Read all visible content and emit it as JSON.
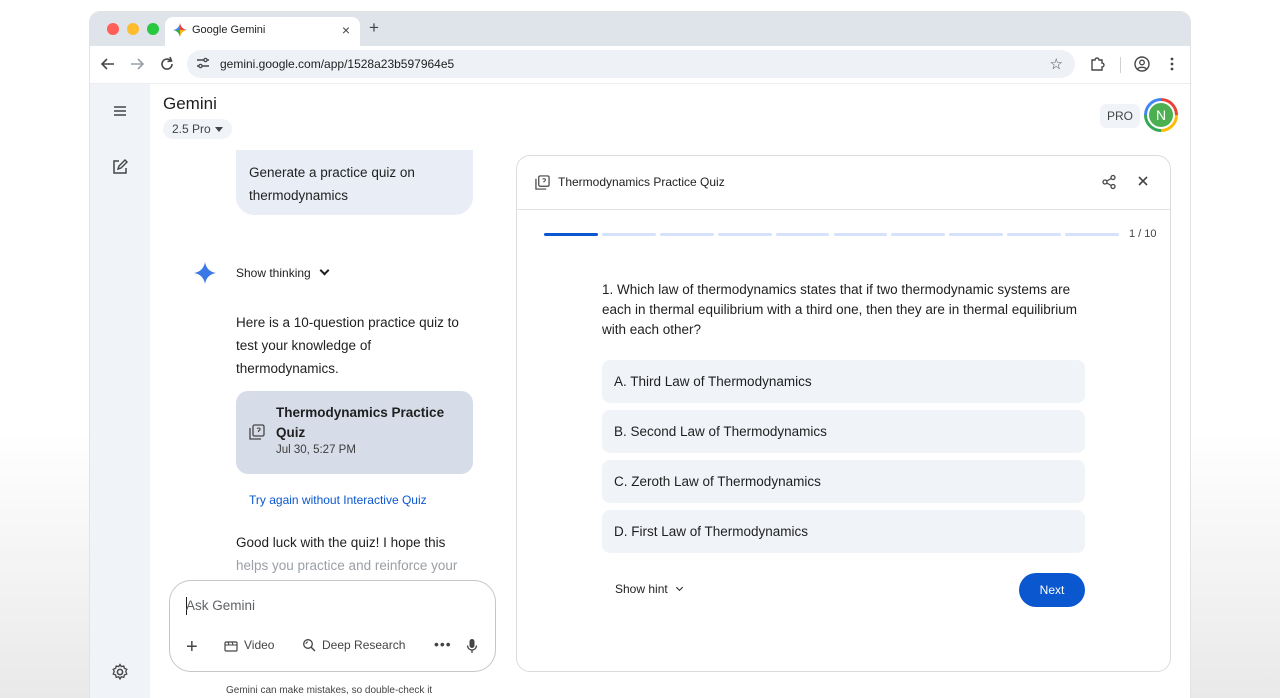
{
  "browser": {
    "tab_title": "Google Gemini",
    "tab_close": "×",
    "new_tab": "+",
    "url": "gemini.google.com/app/1528a23b597964e5"
  },
  "app": {
    "brand": "Gemini",
    "model": "2.5 Pro",
    "pro_badge": "PRO",
    "avatar_initial": "N"
  },
  "chat": {
    "user_prompt": "Generate a practice quiz on thermodynamics",
    "show_thinking": "Show thinking",
    "response_intro": "Here is a 10-question practice quiz to test your knowledge of thermodynamics.",
    "quiz_card": {
      "title": "Thermodynamics Practice Quiz",
      "date": "Jul 30, 5:27 PM"
    },
    "try_again": "Try again without Interactive Quiz",
    "response_outro_visible": "Good luck with the quiz! I hope this",
    "response_outro_faded": "helps you practice and reinforce your"
  },
  "composer": {
    "placeholder": "Ask Gemini",
    "tools": {
      "video": "Video",
      "deep_research": "Deep Research"
    },
    "more": "•••"
  },
  "disclaimer": "Gemini can make mistakes, so double-check it",
  "quiz": {
    "title": "Thermodynamics Practice Quiz",
    "progress": {
      "current": 1,
      "total": 10,
      "label": "1 / 10"
    },
    "question": "1. Which law of thermodynamics states that if two thermodynamic systems are each in thermal equilibrium with a third one, then they are in thermal equilibrium with each other?",
    "options": [
      "A.  Third Law of Thermodynamics",
      "B.  Second Law of Thermodynamics",
      "C.  Zeroth Law of Thermodynamics",
      "D.  First Law of Thermodynamics"
    ],
    "show_hint": "Show hint",
    "next": "Next"
  },
  "colors": {
    "accent": "#0b57d0",
    "progress_inactive": "#d6e2fb",
    "rail_bg": "#f0f3f8",
    "option_bg": "#f0f3f8",
    "quiz_card_bg": "#d7dde8"
  }
}
